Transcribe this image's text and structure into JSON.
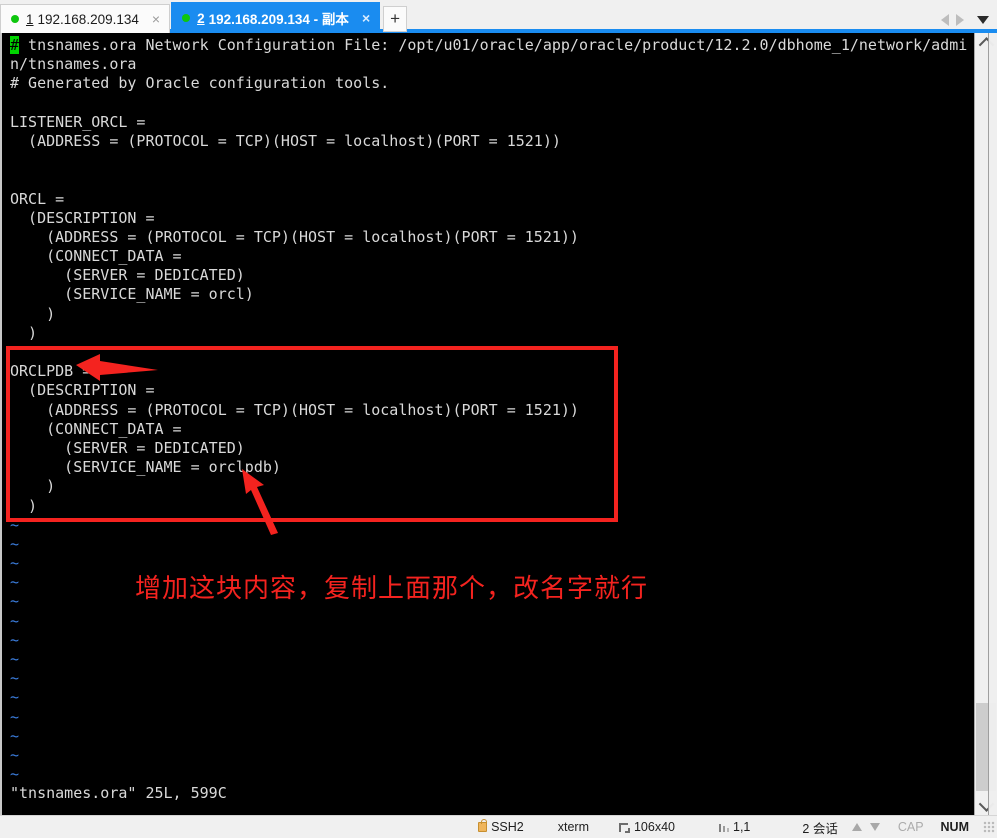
{
  "window": {
    "tabs": [
      {
        "index": "1",
        "label": "192.168.209.134",
        "active": false,
        "close": "×",
        "status_dot": "green"
      },
      {
        "index": "2",
        "label": "192.168.209.134 - 副本",
        "active": true,
        "close": "×",
        "status_dot": "green"
      }
    ],
    "new_tab_label": "+",
    "tab_nav": {
      "prev": "prev-tab",
      "next": "next-tab",
      "list": "tab-list"
    }
  },
  "terminal": {
    "editor": "vim",
    "file": "tnsnames.ora",
    "cursor_char": "#",
    "lines": [
      "# tnsnames.ora Network Configuration File: /opt/u01/oracle/app/oracle/product/12.2.0/dbhome_1/network/admi",
      "n/tnsnames.ora",
      "# Generated by Oracle configuration tools.",
      "",
      "LISTENER_ORCL =",
      "  (ADDRESS = (PROTOCOL = TCP)(HOST = localhost)(PORT = 1521))",
      "",
      "",
      "ORCL =",
      "  (DESCRIPTION =",
      "    (ADDRESS = (PROTOCOL = TCP)(HOST = localhost)(PORT = 1521))",
      "    (CONNECT_DATA =",
      "      (SERVER = DEDICATED)",
      "      (SERVICE_NAME = orcl)",
      "    )",
      "  )",
      "",
      "ORCLPDB =",
      "  (DESCRIPTION =",
      "    (ADDRESS = (PROTOCOL = TCP)(HOST = localhost)(PORT = 1521))",
      "    (CONNECT_DATA =",
      "      (SERVER = DEDICATED)",
      "      (SERVICE_NAME = orclpdb)",
      "    )",
      "  )"
    ],
    "empty_marker": "~",
    "empty_marker_count": 14,
    "status_line": "\"tnsnames.ora\" 25L, 599C"
  },
  "annotations": {
    "box_color": "#f4231f",
    "note_text": "增加这块内容，复制上面那个，改名字就行",
    "arrows": [
      {
        "name": "arrow-to-orclpdb-name",
        "points_to": "ORCLPDB"
      },
      {
        "name": "arrow-to-service-name",
        "points_to": "orclpdb"
      }
    ]
  },
  "statusbar": {
    "protocol": "SSH2",
    "term_type": "xterm",
    "size": "106x40",
    "position": "1,1",
    "sessions": "2 会话",
    "caps": "CAP",
    "num": "NUM"
  }
}
